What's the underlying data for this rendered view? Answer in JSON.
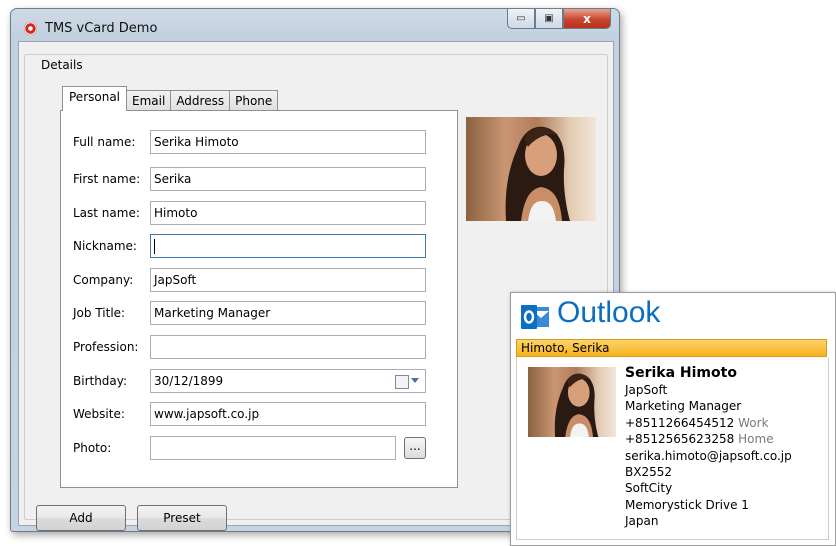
{
  "window": {
    "title": "TMS vCard Demo",
    "minimize_glyph": "▭",
    "maximize_glyph": "▣",
    "close_glyph": "x"
  },
  "group": {
    "label": "Details"
  },
  "tabs": [
    {
      "label": "Personal",
      "active": true
    },
    {
      "label": "Email",
      "active": false
    },
    {
      "label": "Address",
      "active": false
    },
    {
      "label": "Phone",
      "active": false
    }
  ],
  "fields": {
    "full_name": {
      "label": "Full name:",
      "value": "Serika Himoto"
    },
    "first_name": {
      "label": "First name:",
      "value": "Serika"
    },
    "last_name": {
      "label": "Last name:",
      "value": "Himoto"
    },
    "nickname": {
      "label": "Nickname:",
      "value": ""
    },
    "company": {
      "label": "Company:",
      "value": "JapSoft"
    },
    "job_title": {
      "label": "Job Title:",
      "value": "Marketing Manager"
    },
    "profession": {
      "label": "Profession:",
      "value": ""
    },
    "birthday": {
      "label": "Birthday:",
      "value": "30/12/1899"
    },
    "website": {
      "label": "Website:",
      "value": "www.japsoft.co.jp"
    },
    "photo": {
      "label": "Photo:",
      "value": "",
      "browse_label": "..."
    }
  },
  "buttons": {
    "add": "Add",
    "preset": "Preset"
  },
  "outlook": {
    "brand": "Outlook",
    "header_name": "Himoto, Serika",
    "name": "Serika Himoto",
    "company": "JapSoft",
    "job_title": "Marketing Manager",
    "phone_work": "+8511266454512",
    "phone_work_label": "Work",
    "phone_home": "+8512565623258",
    "phone_home_label": "Home",
    "email": "serika.himoto@japsoft.co.jp",
    "address_lines": [
      "BX2552",
      "SoftCity",
      "Memorystick Drive 1",
      "Japan"
    ],
    "colors": {
      "brand_blue": "#0a6fc2",
      "header_bar": "#f6b21d"
    }
  }
}
